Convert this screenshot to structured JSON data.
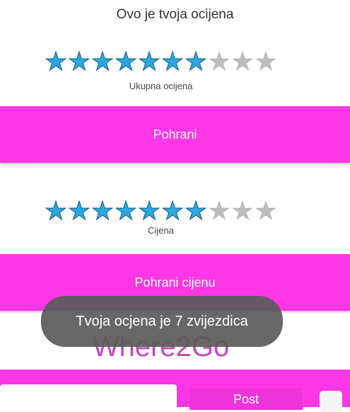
{
  "header_text": "Ovo je tvoja ocijena",
  "rating_overall": {
    "label": "Ukupna ocijena",
    "filled": 7,
    "total": 10
  },
  "save_button_label": "Pohrani",
  "rating_price": {
    "label": "Cijena",
    "filled": 7,
    "total": 10
  },
  "save_price_button_label": "Pohrani cijenu",
  "app_name": "Where2Go",
  "toast_text": "Tvoja ocjena je 7 zvijezdica",
  "post_button_label": "Post",
  "colors": {
    "accent": "#ff37e6",
    "star_on": "#2aa8e0",
    "star_off": "#bdbdbd",
    "app_name": "#c24ab8"
  }
}
